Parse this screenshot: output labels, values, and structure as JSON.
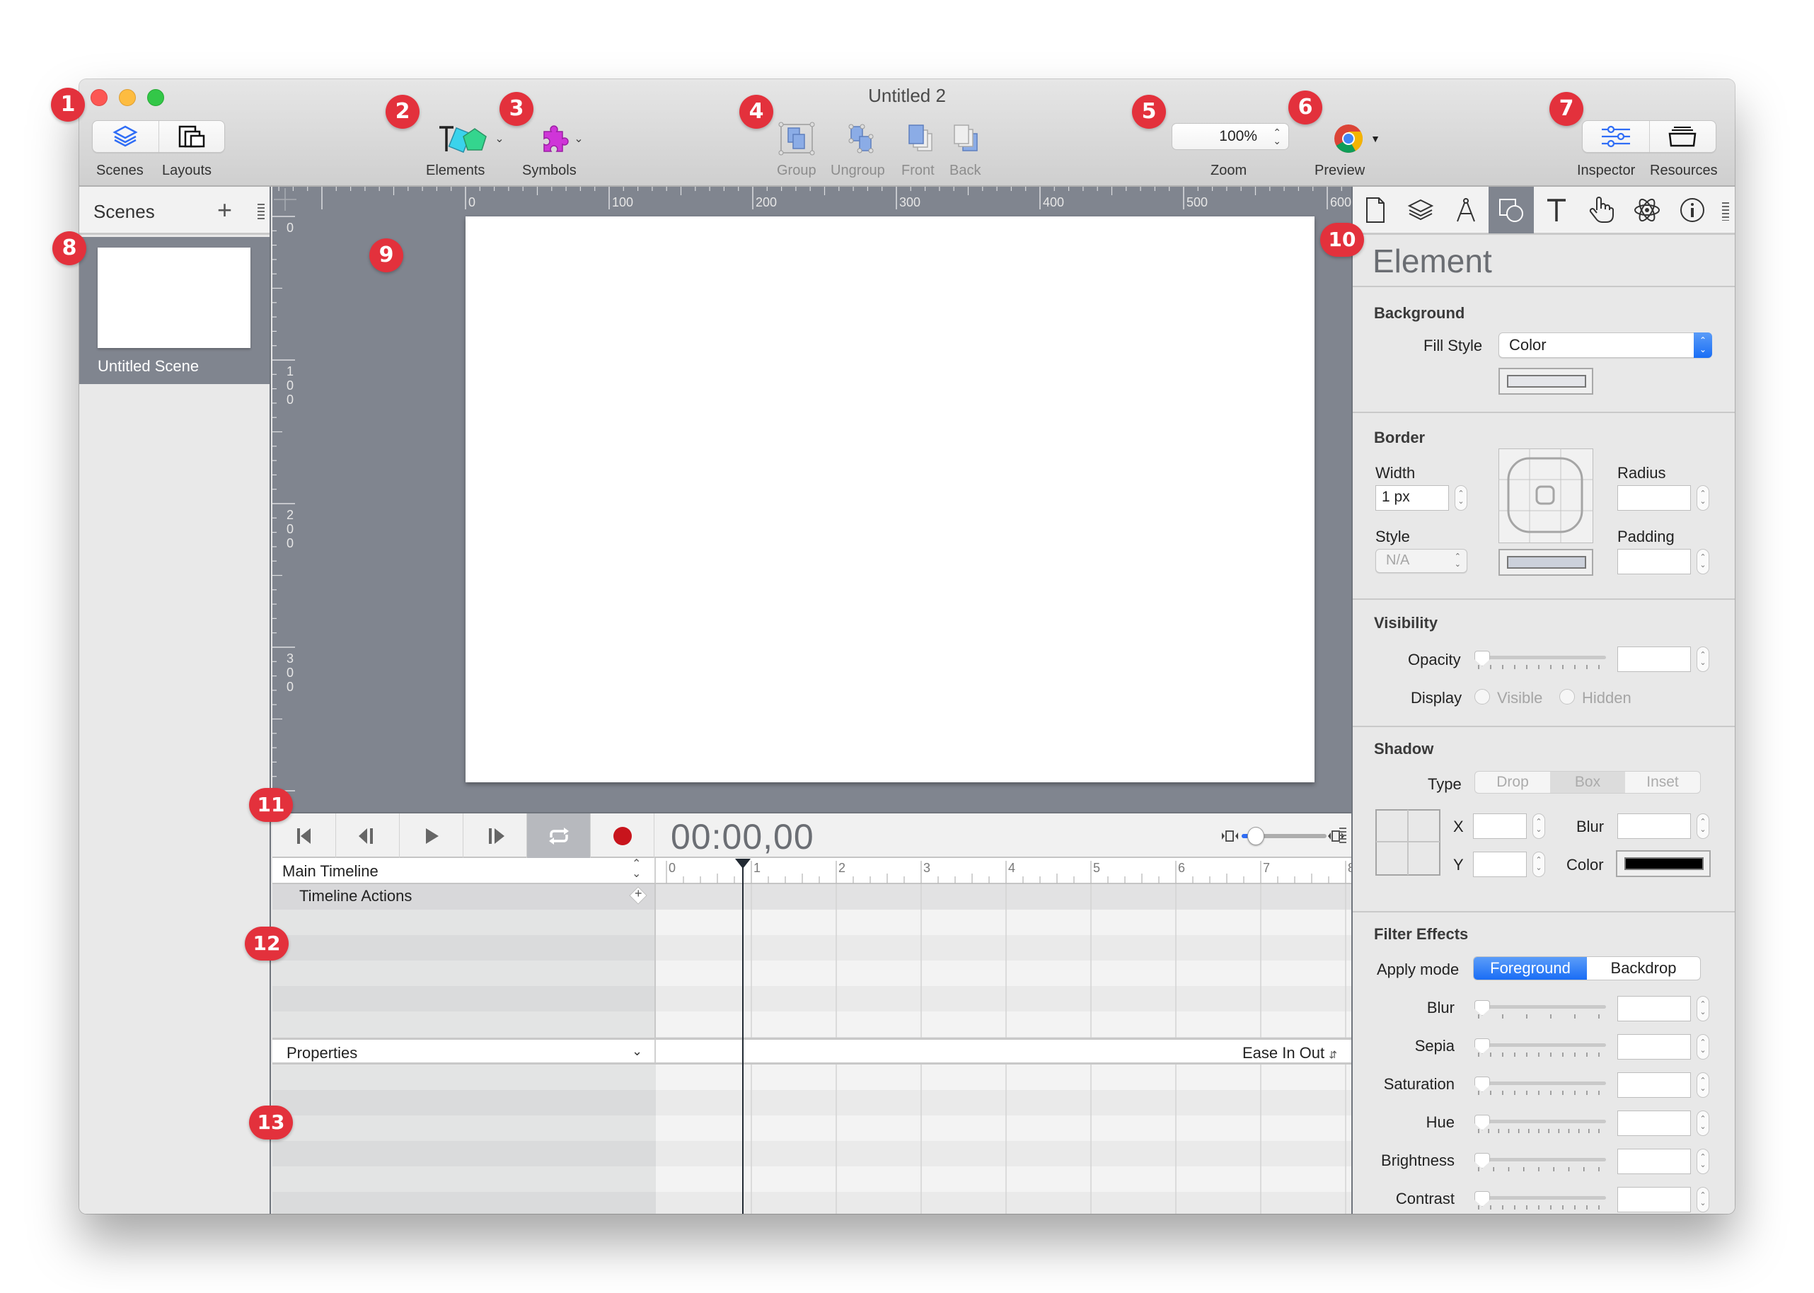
{
  "window": {
    "title": "Untitled 2"
  },
  "toolbar": {
    "scenes_label": "Scenes",
    "layouts_label": "Layouts",
    "elements_label": "Elements",
    "symbols_label": "Symbols",
    "group_label": "Group",
    "ungroup_label": "Ungroup",
    "front_label": "Front",
    "back_label": "Back",
    "zoom_value": "100%",
    "zoom_label": "Zoom",
    "preview_label": "Preview",
    "inspector_label": "Inspector",
    "resources_label": "Resources",
    "accent_color": "#2f6df6"
  },
  "sidebar": {
    "title": "Scenes",
    "add_icon": "+",
    "scenes": [
      {
        "name": "Untitled Scene"
      }
    ]
  },
  "canvas": {
    "ruler_x_labels": [
      "0",
      "100",
      "200",
      "300",
      "400",
      "500",
      "600"
    ],
    "ruler_y_labels": [
      "0",
      "100",
      "200",
      "300"
    ]
  },
  "timeline": {
    "timecode": "00:00,00",
    "zoom_fraction": 0.17,
    "timeline_name": "Main Timeline",
    "actions_label": "Timeline Actions",
    "ruler_labels": [
      "0",
      "1",
      "2",
      "3",
      "4",
      "5",
      "6",
      "7",
      "8"
    ],
    "properties_label": "Properties",
    "easing": "Ease In Out",
    "record_color": "#c8141c"
  },
  "inspector": {
    "tabs": [
      "document",
      "scene",
      "metrics",
      "element",
      "text",
      "actions",
      "physics",
      "identity"
    ],
    "active_tab": "element",
    "title": "Element",
    "background": {
      "section": "Background",
      "fill_style_label": "Fill Style",
      "fill_style_value": "Color",
      "fill_color": "#e4e5e9"
    },
    "border": {
      "section": "Border",
      "width_label": "Width",
      "width_value": "1 px",
      "style_label": "Style",
      "style_value": "N/A",
      "radius_label": "Radius",
      "radius_value": "",
      "padding_label": "Padding",
      "padding_value": "",
      "border_color": "#ccd1db"
    },
    "visibility": {
      "section": "Visibility",
      "opacity_label": "Opacity",
      "opacity_value": "",
      "display_label": "Display",
      "visible_label": "Visible",
      "hidden_label": "Hidden"
    },
    "shadow": {
      "section": "Shadow",
      "type_label": "Type",
      "types": [
        "Drop",
        "Box",
        "Inset"
      ],
      "selected_type": "Box",
      "x_label": "X",
      "y_label": "Y",
      "blur_label": "Blur",
      "color_label": "Color",
      "x_value": "",
      "y_value": "",
      "blur_value": "",
      "shadow_color": "#000000"
    },
    "filters": {
      "section": "Filter Effects",
      "apply_mode_label": "Apply mode",
      "modes": [
        "Foreground",
        "Backdrop"
      ],
      "selected_mode": "Foreground",
      "items": [
        {
          "label": "Blur",
          "value": ""
        },
        {
          "label": "Sepia",
          "value": ""
        },
        {
          "label": "Saturation",
          "value": ""
        },
        {
          "label": "Hue",
          "value": ""
        },
        {
          "label": "Brightness",
          "value": ""
        },
        {
          "label": "Contrast",
          "value": ""
        }
      ]
    }
  },
  "annotations": [
    "1",
    "2",
    "3",
    "4",
    "5",
    "6",
    "7",
    "8",
    "9",
    "10",
    "11",
    "12",
    "13"
  ],
  "annotation_color": "#e3313c"
}
